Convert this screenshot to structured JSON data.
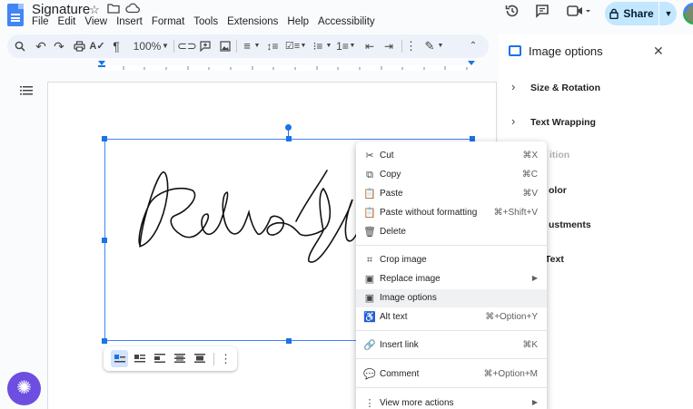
{
  "app": {
    "title": "Signature",
    "menu": [
      "File",
      "Edit",
      "View",
      "Insert",
      "Format",
      "Tools",
      "Extensions",
      "Help",
      "Accessibility"
    ],
    "share_label": "Share"
  },
  "toolbar": {
    "zoom": "100%"
  },
  "panel": {
    "title": "Image options",
    "sections": [
      {
        "label": "Size & Rotation"
      },
      {
        "label": "Text Wrapping"
      },
      {
        "label": "Position",
        "visible": "ition"
      },
      {
        "label": "Recolor",
        "visible": "olor"
      },
      {
        "label": "Adjustments",
        "visible": "ustments"
      },
      {
        "label": "Alt Text",
        "visible": "Text"
      }
    ]
  },
  "context_menu": {
    "items": [
      {
        "label": "Cut",
        "shortcut": "⌘X",
        "icon": "scissors-icon"
      },
      {
        "label": "Copy",
        "shortcut": "⌘C",
        "icon": "copy-icon"
      },
      {
        "label": "Paste",
        "shortcut": "⌘V",
        "icon": "paste-icon"
      },
      {
        "label": "Paste without formatting",
        "shortcut": "⌘+Shift+V",
        "icon": "paste-plain-icon"
      },
      {
        "label": "Delete",
        "shortcut": "",
        "icon": "trash-icon"
      },
      {
        "label": "Crop image",
        "shortcut": "",
        "icon": "crop-icon"
      },
      {
        "label": "Replace image",
        "shortcut": "",
        "icon": "image-icon",
        "submenu": true
      },
      {
        "label": "Image options",
        "shortcut": "",
        "icon": "image-options-icon",
        "highlighted": true
      },
      {
        "label": "Alt text",
        "shortcut": "⌘+Option+Y",
        "icon": "accessibility-icon"
      },
      {
        "label": "Insert link",
        "shortcut": "⌘K",
        "icon": "link-icon"
      },
      {
        "label": "Comment",
        "shortcut": "⌘+Option+M",
        "icon": "comment-icon"
      },
      {
        "label": "View more actions",
        "shortcut": "",
        "icon": "more-icon",
        "submenu": true
      }
    ]
  },
  "colors": {
    "accent": "#1a73e8",
    "share_bg": "#c2e7ff",
    "toolbar_bg": "#edf2fa",
    "fab": "#6c4fe0"
  }
}
